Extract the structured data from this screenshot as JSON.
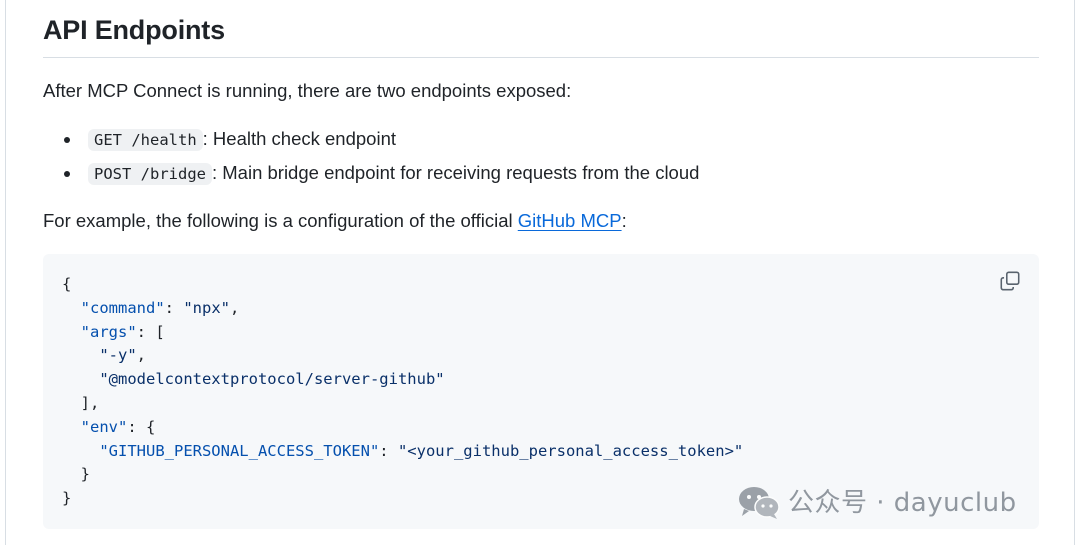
{
  "heading": "API Endpoints",
  "intro": "After MCP Connect is running, there are two endpoints exposed:",
  "endpoints": [
    {
      "code": "GET /health",
      "description": ": Health check endpoint"
    },
    {
      "code": "POST /bridge",
      "description": ": Main bridge endpoint for receiving requests from the cloud"
    }
  ],
  "example": {
    "prefix": "For example, the following is a configuration of the official ",
    "link_text": "GitHub MCP",
    "suffix": ":"
  },
  "code_block": {
    "lines": [
      [
        {
          "t": "p",
          "v": "{"
        }
      ],
      [
        {
          "t": "p",
          "v": "  "
        },
        {
          "t": "k",
          "v": "\"command\""
        },
        {
          "t": "p",
          "v": ": "
        },
        {
          "t": "s",
          "v": "\"npx\""
        },
        {
          "t": "p",
          "v": ","
        }
      ],
      [
        {
          "t": "p",
          "v": "  "
        },
        {
          "t": "k",
          "v": "\"args\""
        },
        {
          "t": "p",
          "v": ": ["
        }
      ],
      [
        {
          "t": "p",
          "v": "    "
        },
        {
          "t": "s",
          "v": "\"-y\""
        },
        {
          "t": "p",
          "v": ","
        }
      ],
      [
        {
          "t": "p",
          "v": "    "
        },
        {
          "t": "s",
          "v": "\"@modelcontextprotocol/server-github\""
        }
      ],
      [
        {
          "t": "p",
          "v": "  ],"
        }
      ],
      [
        {
          "t": "p",
          "v": "  "
        },
        {
          "t": "k",
          "v": "\"env\""
        },
        {
          "t": "p",
          "v": ": {"
        }
      ],
      [
        {
          "t": "p",
          "v": "    "
        },
        {
          "t": "k",
          "v": "\"GITHUB_PERSONAL_ACCESS_TOKEN\""
        },
        {
          "t": "p",
          "v": ": "
        },
        {
          "t": "s",
          "v": "\"<your_github_personal_access_token>\""
        }
      ],
      [
        {
          "t": "p",
          "v": "  }"
        }
      ],
      [
        {
          "t": "p",
          "v": "}"
        }
      ]
    ],
    "copy_icon": "copy-icon"
  },
  "watermark": {
    "icon": "wechat-icon",
    "text": "公众号 · dayuclub"
  },
  "colors": {
    "text": "#1f2328",
    "link": "#0969da",
    "code_bg": "#f6f8fa",
    "inline_code_bg": "#eff1f3",
    "json_key": "#0550ae",
    "json_string": "#0a3069"
  }
}
